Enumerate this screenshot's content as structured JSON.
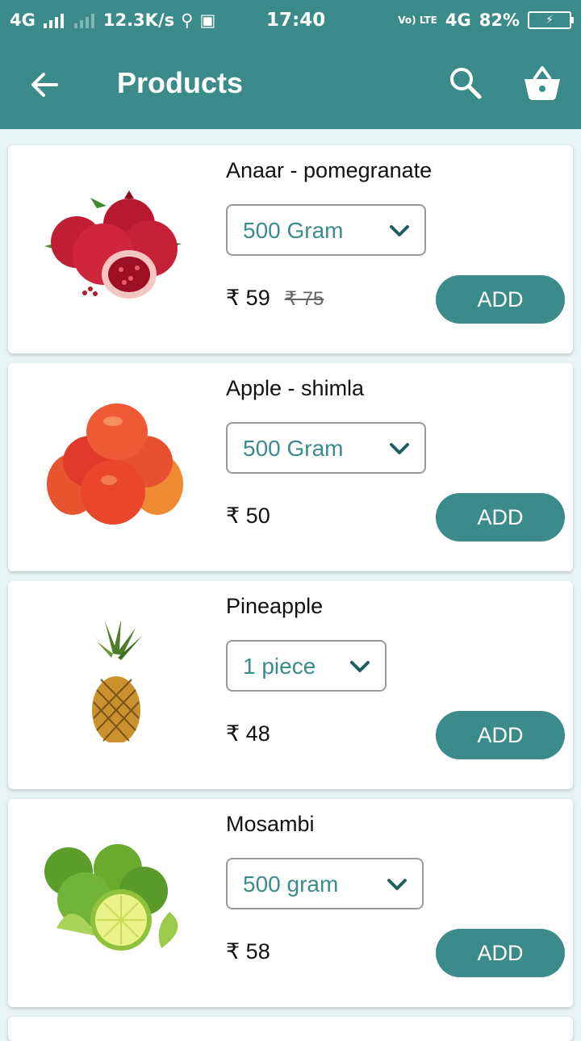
{
  "status_bar": {
    "network": "4G",
    "speed": "12.3K/s",
    "time": "17:40",
    "volte": "Vo) LTE",
    "network2": "4G",
    "battery": "82%"
  },
  "app_bar": {
    "title": "Products",
    "back_icon": "back-arrow-icon",
    "search_icon": "search-icon",
    "cart_icon": "basket-icon"
  },
  "products": [
    {
      "name": "Anaar - pomegranate",
      "unit": "500 Gram",
      "price": "₹ 59",
      "old_price": "₹ 75",
      "add_label": "ADD",
      "image": "pomegranate"
    },
    {
      "name": "Apple - shimla",
      "unit": "500 Gram",
      "price": "₹ 50",
      "old_price": "",
      "add_label": "ADD",
      "image": "apple"
    },
    {
      "name": "Pineapple",
      "unit": "1 piece",
      "price": "₹ 48",
      "old_price": "",
      "add_label": "ADD",
      "image": "pineapple"
    },
    {
      "name": "Mosambi",
      "unit": "500 gram",
      "price": "₹ 58",
      "old_price": "",
      "add_label": "ADD",
      "image": "mosambi"
    }
  ],
  "colors": {
    "primary": "#3a8b89",
    "background": "#e6f4f3"
  }
}
